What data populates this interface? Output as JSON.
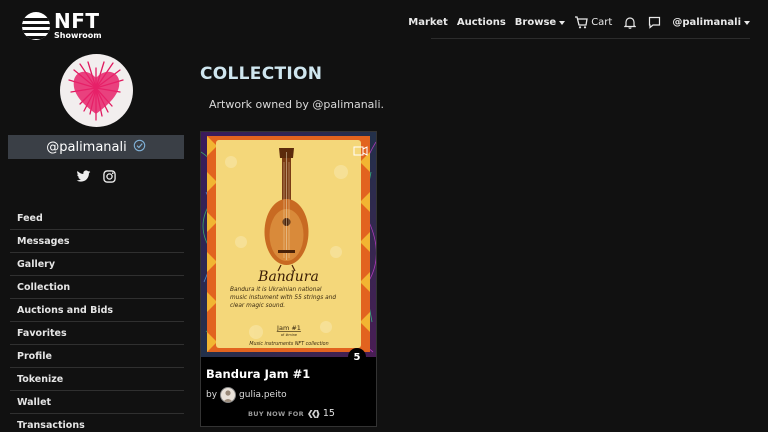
{
  "brand": {
    "title": "NFT",
    "subtitle": "Showroom"
  },
  "nav": {
    "market": "Market",
    "auctions": "Auctions",
    "browse": "Browse",
    "cart": "Cart",
    "user": "@palimanali"
  },
  "profile": {
    "username": "@palimanali"
  },
  "sidebar": {
    "items": [
      {
        "label": "Feed"
      },
      {
        "label": "Messages"
      },
      {
        "label": "Gallery"
      },
      {
        "label": "Collection"
      },
      {
        "label": "Auctions and Bids"
      },
      {
        "label": "Favorites"
      },
      {
        "label": "Profile"
      },
      {
        "label": "Tokenize"
      },
      {
        "label": "Wallet"
      },
      {
        "label": "Transactions"
      }
    ]
  },
  "main": {
    "title": "COLLECTION",
    "subtitle": "Artwork owned by @palimanali."
  },
  "card": {
    "art_title": "Bandura",
    "art_desc_1": "Bandura it is Ukrainian national",
    "art_desc_2": "music instument with 55 strings and",
    "art_desc_3": "clear magic sound.",
    "art_tag": "Jam #1",
    "art_tag_sub": "of #mine",
    "art_footer": "Music instruments NFT collection",
    "edition_count": "5",
    "title": "Bandura Jam #1",
    "by_label": "by",
    "creator": "gulia.peito",
    "buy_label": "BUY NOW FOR",
    "price": "15"
  },
  "colors": {
    "background": "#111111",
    "title_accent": "#cfe6ef",
    "username_bar": "#3a3f46",
    "verified": "#7fb0d6",
    "art_frame": "#f4d77a",
    "art_border_orange": "#e2631f"
  },
  "icons": [
    "cart-icon",
    "bell-icon",
    "chat-icon",
    "verified-icon",
    "twitter-icon",
    "instagram-icon",
    "video-icon",
    "hive-icon"
  ]
}
